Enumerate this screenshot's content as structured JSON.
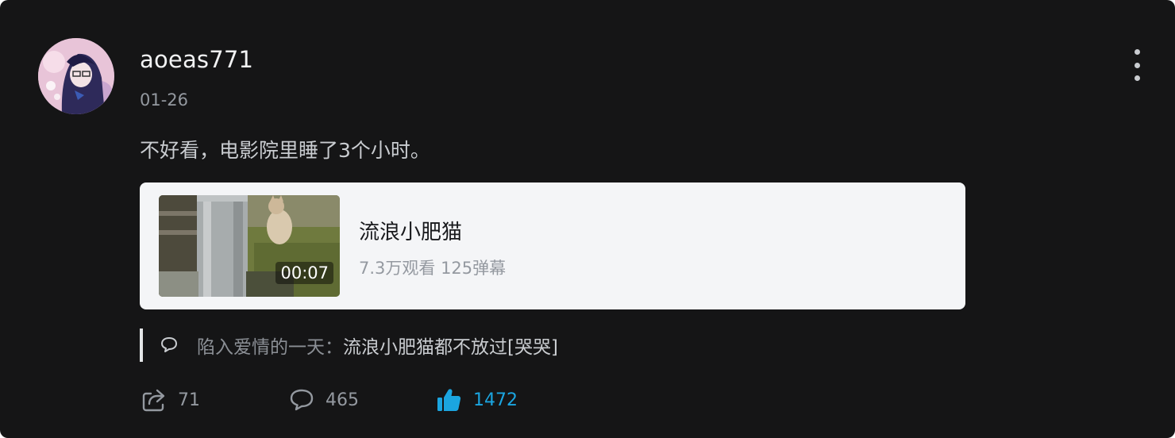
{
  "post": {
    "username": "aoeas771",
    "date": "01-26",
    "content": "不好看，电影院里睡了3个小时。"
  },
  "video": {
    "duration": "00:07",
    "title": "流浪小肥猫",
    "stats": "7.3万观看 125弹幕"
  },
  "reply": {
    "user": "陷入爱情的一天：",
    "text": "流浪小肥猫都不放过[哭哭]"
  },
  "actions": {
    "share_count": "71",
    "comment_count": "465",
    "like_count": "1472"
  },
  "icons": {
    "more": "more-vertical-icon",
    "reply": "comment-bubble-icon",
    "share": "share-icon",
    "comment": "comment-icon",
    "like": "thumbs-up-icon"
  },
  "colors": {
    "background": "#151516",
    "card": "#f4f5f7",
    "accent": "#1ba5e0",
    "muted": "#9499a0"
  }
}
